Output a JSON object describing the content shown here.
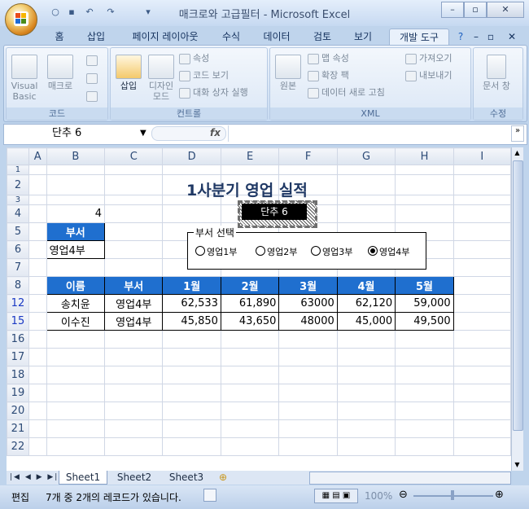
{
  "window": {
    "title": "매크로와 고급필터 - Microsoft Excel"
  },
  "tabs": [
    "홈",
    "삽입",
    "페이지 레이아웃",
    "수식",
    "데이터",
    "검토",
    "보기",
    "개발 도구"
  ],
  "ribbon": {
    "code": {
      "label": "코드",
      "visual_basic": "Visual Basic",
      "macro": "매크로"
    },
    "controls": {
      "label": "컨트롤",
      "insert": "삽입",
      "design_mode": "디자인 모드",
      "properties": "속성",
      "view_code": "코드 보기",
      "run_dialog": "대화 상자 실행"
    },
    "xml": {
      "label": "XML",
      "source": "원본",
      "map_properties": "맵 속성",
      "expansion_pack": "확장 팩",
      "refresh_data": "데이터 새로 고침",
      "import": "가져오기",
      "export": "내보내기"
    },
    "modify": {
      "label": "수정",
      "doc_panel": "문서 창"
    }
  },
  "formula_bar": {
    "name_box": "단추 6",
    "fx": "fx",
    "content": ""
  },
  "columns": [
    "A",
    "B",
    "C",
    "D",
    "E",
    "F",
    "G",
    "H",
    "I"
  ],
  "rows": [
    "1",
    "2",
    "3",
    "4",
    "5",
    "6",
    "7",
    "8",
    "12",
    "15",
    "16",
    "17",
    "18",
    "19",
    "20",
    "21",
    "22"
  ],
  "sheet": {
    "title": "1사분기 영업 실적",
    "b4_value": "4",
    "dept_header": "부서",
    "dept_value": "영업4부",
    "frame_label": "부서 선택",
    "radio_options": [
      "영업1부",
      "영업2부",
      "영업3부",
      "영업4부"
    ],
    "selected_radio": "영업4부",
    "macro_button": "단추 6",
    "table_headers": [
      "이름",
      "부서",
      "1월",
      "2월",
      "3월",
      "4월",
      "5월"
    ],
    "table_rows": [
      {
        "row": "12",
        "cells": [
          "송치윤",
          "영업4부",
          "62,533",
          "61,890",
          "63000",
          "62,120",
          "59,000"
        ]
      },
      {
        "row": "15",
        "cells": [
          "이수진",
          "영업4부",
          "45,850",
          "43,650",
          "48000",
          "45,000",
          "49,500"
        ]
      }
    ]
  },
  "sheet_tabs": [
    "Sheet1",
    "Sheet2",
    "Sheet3"
  ],
  "status": {
    "mode": "편집",
    "message": "7개 중 2개의 레코드가 있습니다.",
    "zoom": "100%"
  },
  "colors": {
    "header_blue": "#1f6fcf",
    "title_navy": "#1f3864",
    "filtered_row_num": "#1a39c4"
  }
}
